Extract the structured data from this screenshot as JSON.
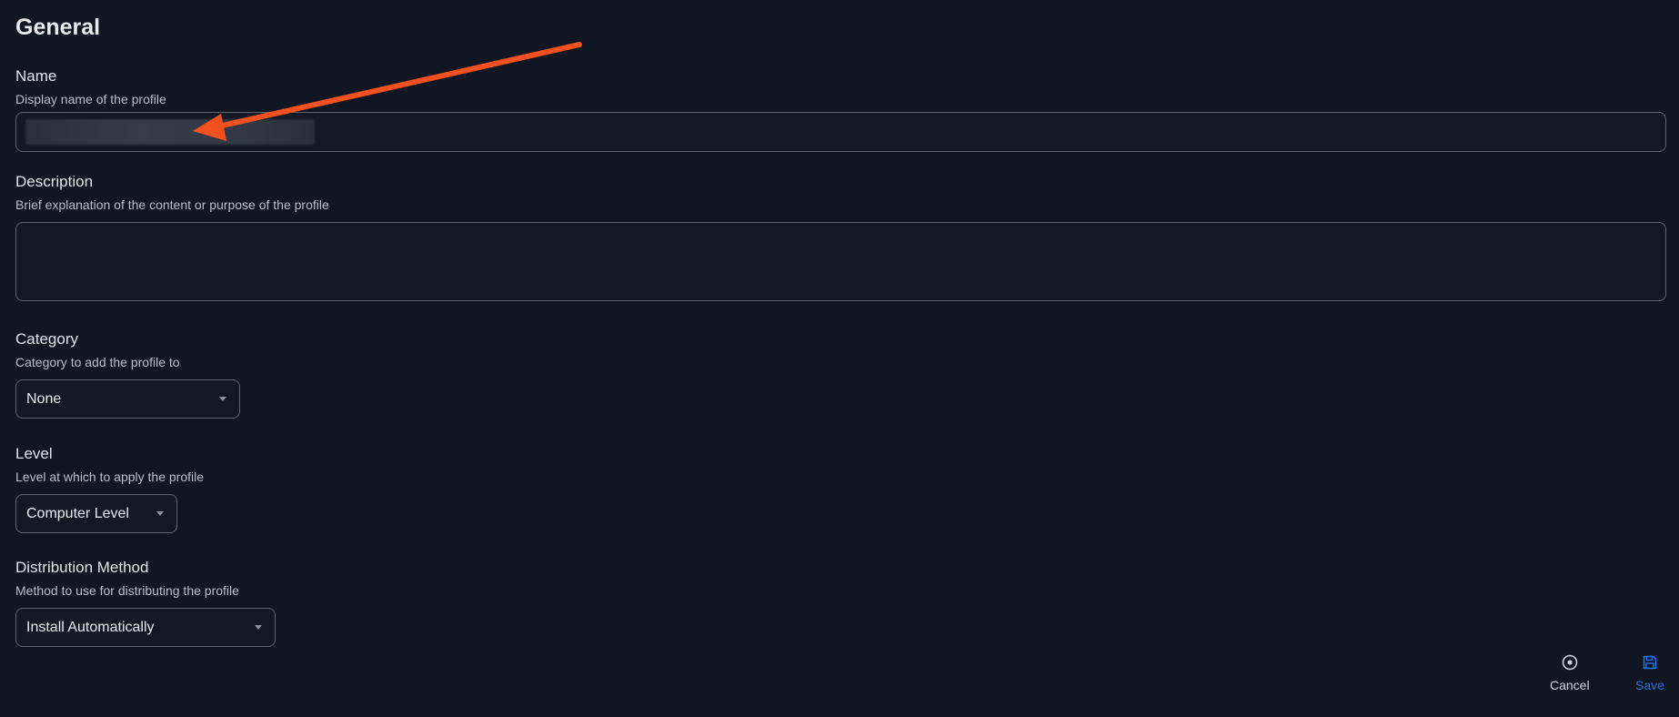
{
  "section": {
    "title": "General"
  },
  "fields": {
    "name": {
      "label": "Name",
      "help": "Display name of the profile",
      "value": ""
    },
    "description": {
      "label": "Description",
      "help": "Brief explanation of the content or purpose of the profile",
      "value": ""
    },
    "category": {
      "label": "Category",
      "help": "Category to add the profile to",
      "selected": "None"
    },
    "level": {
      "label": "Level",
      "help": "Level at which to apply the profile",
      "selected": "Computer Level"
    },
    "distribution": {
      "label": "Distribution Method",
      "help": "Method to use for distributing the profile",
      "selected": "Install Automatically"
    }
  },
  "actions": {
    "cancel": {
      "label": "Cancel",
      "icon": "cancel-circle-icon"
    },
    "save": {
      "label": "Save",
      "icon": "floppy-disk-icon"
    }
  },
  "colors": {
    "background": "#111722",
    "border": "#5d6470",
    "primary": "#1f6fe0",
    "annotation": "#f2501e"
  }
}
